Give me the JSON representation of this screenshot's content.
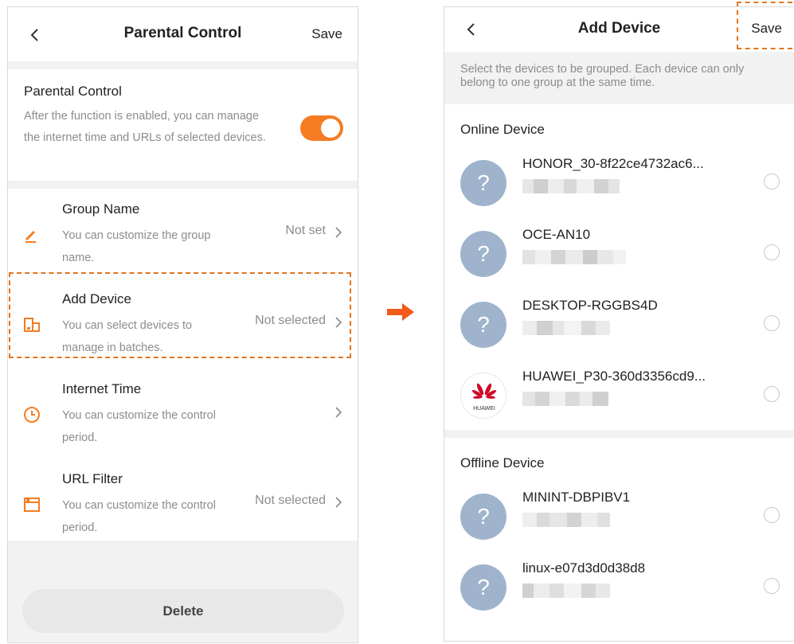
{
  "left": {
    "header": {
      "title": "Parental Control",
      "save_label": "Save"
    },
    "pc": {
      "title": "Parental Control",
      "description": "After the function is enabled, you can manage the internet time and URLs of selected devices.",
      "enabled": true,
      "toggle_color": "#f57c22"
    },
    "rows": [
      {
        "title": "Group Name",
        "desc": "You can customize the group name.",
        "value": "Not set",
        "icon": "pencil-icon"
      },
      {
        "title": "Add Device",
        "desc": "You can select devices to manage in batches.",
        "value": "Not selected",
        "icon": "device-icon"
      },
      {
        "title": "Internet Time",
        "desc": "You can customize the control period.",
        "value": "",
        "icon": "clock-icon"
      },
      {
        "title": "URL Filter",
        "desc": "You can customize the control period.",
        "value": "Not selected",
        "icon": "browser-icon"
      }
    ],
    "delete_label": "Delete"
  },
  "right": {
    "header": {
      "title": "Add Device",
      "save_label": "Save"
    },
    "hint": "Select the devices to be grouped. Each device can only belong to one group at the same time.",
    "online_title": "Online Device",
    "offline_title": "Offline Device",
    "online": [
      {
        "name": "HONOR_30-8f22ce4732ac6...",
        "avatar": "?",
        "type": "unknown"
      },
      {
        "name": "OCE-AN10",
        "avatar": "?",
        "type": "unknown"
      },
      {
        "name": "DESKTOP-RGGBS4D",
        "avatar": "?",
        "type": "unknown"
      },
      {
        "name": "HUAWEI_P30-360d3356cd9...",
        "avatar": "HUAWEI",
        "type": "huawei"
      }
    ],
    "offline": [
      {
        "name": "MININT-DBPIBV1",
        "avatar": "?",
        "type": "unknown"
      },
      {
        "name": "linux-e07d3d0d38d8",
        "avatar": "?",
        "type": "unknown"
      }
    ]
  },
  "colors": {
    "accent": "#f57c22",
    "highlight": "#e0761f",
    "avatar": "#9fb4cc",
    "huawei_red": "#cf0a2c"
  }
}
